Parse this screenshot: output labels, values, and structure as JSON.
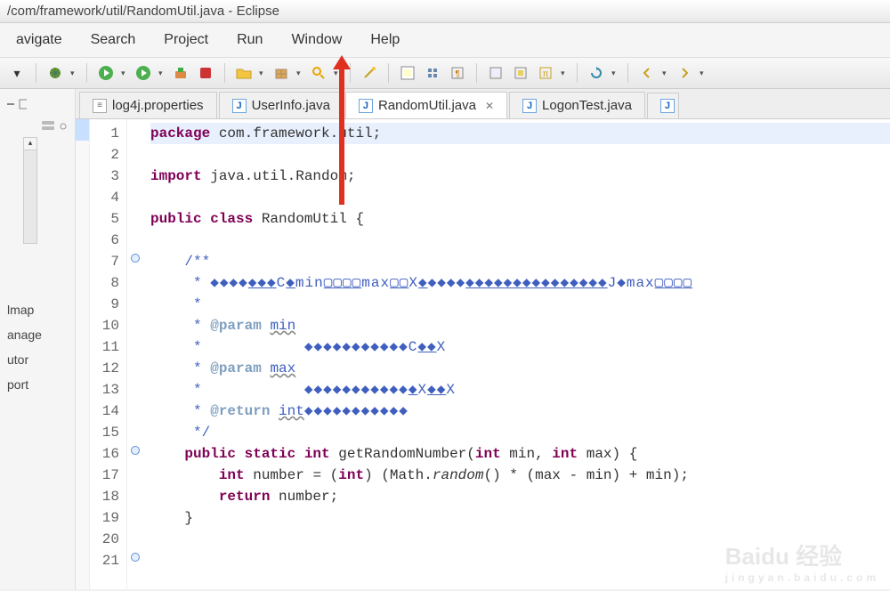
{
  "title": "/com/framework/util/RandomUtil.java - Eclipse",
  "menus": [
    "avigate",
    "Search",
    "Project",
    "Run",
    "Window",
    "Help"
  ],
  "tabs": [
    {
      "label": "log4j.properties",
      "icon": "properties",
      "active": false
    },
    {
      "label": "UserInfo.java",
      "icon": "java",
      "hasArrow": true,
      "active": false
    },
    {
      "label": "RandomUtil.java",
      "icon": "java",
      "active": true,
      "closable": true
    },
    {
      "label": "LogonTest.java",
      "icon": "java",
      "active": false
    }
  ],
  "outline": [
    "lmap",
    "anage",
    "utor",
    "port"
  ],
  "code": {
    "lines": [
      {
        "n": 1,
        "fold": "",
        "html": "<span class='hl-line'><span class='kw'>package</span> com.framework.util;</span>"
      },
      {
        "n": 2,
        "fold": "",
        "html": ""
      },
      {
        "n": 3,
        "fold": "",
        "html": "<span class='kw'>import</span> java.util.Random;"
      },
      {
        "n": 4,
        "fold": "",
        "html": ""
      },
      {
        "n": 5,
        "fold": "",
        "html": "<span class='kw'>public class</span> RandomUtil {"
      },
      {
        "n": 6,
        "fold": "",
        "html": ""
      },
      {
        "n": 7,
        "fold": "o",
        "html": "    <span class='doc'>/**</span>"
      },
      {
        "n": 8,
        "fold": "",
        "html": "     <span class='doc'>* </span><span class='garble'>◆◆◆◆<u>◆◆◆</u>C<u>◆</u>min<u>▢▢▢▢</u>max<u>▢▢</u>X<u>◆</u>◆◆◆◆<u>◆◆◆◆◆◆◆◆◆◆◆◆◆◆◆</u>J◆max<u>▢▢▢▢</u></span>"
      },
      {
        "n": 9,
        "fold": "",
        "html": "     <span class='doc'>*</span>"
      },
      {
        "n": 10,
        "fold": "",
        "html": "     <span class='doc'>* </span><span class='doctag'>@param</span> <span class='docund'>min</span>"
      },
      {
        "n": 11,
        "fold": "",
        "html": "     <span class='doc'>*            </span><span class='garble'>◆◆◆◆◆◆◆◆◆◆◆C<u>◆◆</u>X</span>"
      },
      {
        "n": 12,
        "fold": "",
        "html": "     <span class='doc'>* </span><span class='doctag'>@param</span> <span class='docund'>max</span>"
      },
      {
        "n": 13,
        "fold": "",
        "html": "     <span class='doc'>*            </span><span class='garble'>◆◆◆◆◆◆◆◆◆◆◆<u>◆</u>X<u>◆◆</u>X</span>"
      },
      {
        "n": 14,
        "fold": "",
        "html": "     <span class='doc'>* </span><span class='doctag'>@return</span> <span class='docund'>int</span><span class='garble'>◆◆◆◆◆◆◆◆◆◆◆</span>"
      },
      {
        "n": 15,
        "fold": "",
        "html": "     <span class='doc'>*/</span>"
      },
      {
        "n": 16,
        "fold": "o",
        "html": "    <span class='kw'>public static int</span> getRandomNumber(<span class='kw'>int</span> min, <span class='kw'>int</span> max) {"
      },
      {
        "n": 17,
        "fold": "",
        "html": "        <span class='kw'>int</span> number = (<span class='kw'>int</span>) (Math.<i>random</i>() * (max - min) + min);"
      },
      {
        "n": 18,
        "fold": "",
        "html": "        <span class='kw'>return</span> number;"
      },
      {
        "n": 19,
        "fold": "",
        "html": "    }"
      },
      {
        "n": 20,
        "fold": "",
        "html": ""
      },
      {
        "n": 21,
        "fold": "o",
        "html": ""
      }
    ]
  },
  "watermark": {
    "main": "Baidu 经验",
    "sub": "jingyan.baidu.com"
  }
}
